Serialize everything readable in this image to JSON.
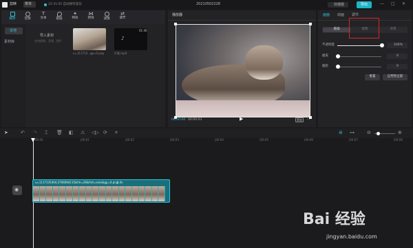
{
  "app": {
    "name": "剪映",
    "menu_label": "菜单",
    "autosave": "22:31:05 自动保存成功",
    "project_title": "20210502228",
    "shortcut": "快捷键",
    "export_label": "导出"
  },
  "toolbar_tabs": [
    {
      "label": "媒体",
      "icon": "media-icon"
    },
    {
      "label": "音频",
      "icon": "audio-icon"
    },
    {
      "label": "文本",
      "icon": "text-icon"
    },
    {
      "label": "贴纸",
      "icon": "sticker-icon"
    },
    {
      "label": "特效",
      "icon": "effects-icon"
    },
    {
      "label": "转场",
      "icon": "transition-icon"
    },
    {
      "label": "滤镜",
      "icon": "filter-icon"
    },
    {
      "label": "调节",
      "icon": "adjust-icon"
    }
  ],
  "media": {
    "side_local": "本地",
    "side_library": "素材库",
    "import_label": "导入素材",
    "import_hint": "支持视频、音频、图片",
    "clip1_name": "u=111713...gp=0.png",
    "clip2_name": "片尾.mp4",
    "clip2_duration": "01:40"
  },
  "player": {
    "title": "播放器",
    "time_current": "00:00:00",
    "time_total": "00:00:03",
    "ratio": "原始"
  },
  "right_panel": {
    "tabs": [
      "画面",
      "动画",
      "调节"
    ],
    "subtabs": [
      "基础",
      "抠像",
      "背景"
    ],
    "rows": [
      {
        "label": "不透明度",
        "value": "100%",
        "fill": 1.0
      },
      {
        "label": "磨皮",
        "value": "0",
        "fill": 0.0
      },
      {
        "label": "瘦脸",
        "value": "0",
        "fill": 0.0
      }
    ],
    "reset_label": "重置",
    "apply_all_label": "应用到全部",
    "highlight_color": "#d9262b"
  },
  "timeline": {
    "ruler": [
      "00:00",
      "|00:01",
      "|00:02",
      "|00:03",
      "|00:04",
      "|00:05",
      "|00:06",
      "|00:07",
      "|00:08"
    ],
    "clip_label": "u=1117135404,3766064115&fm=26&fmt=auto&gp=0.png",
    "clip_duration": "3.0s"
  },
  "watermark": {
    "brand": "Bai 经验",
    "url": "jingyan.baidu.com"
  }
}
